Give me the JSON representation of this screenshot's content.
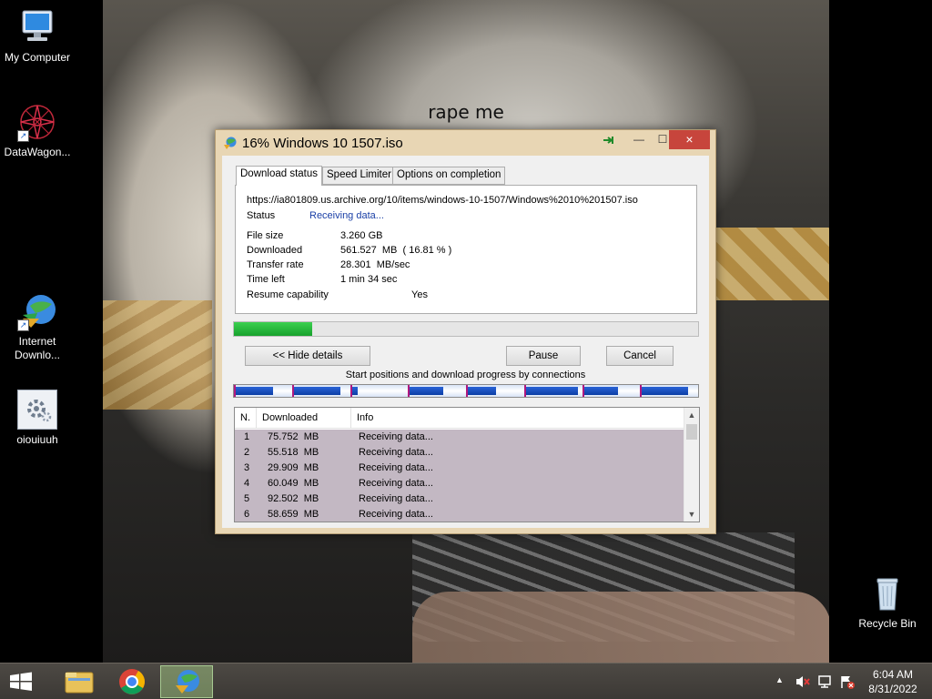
{
  "wallpaper": {
    "caption": "rape me"
  },
  "desktop_icons": [
    {
      "label": "My Computer"
    },
    {
      "label": "DataWagon..."
    },
    {
      "label": "Internet\nDownlo..."
    },
    {
      "label": "oiouiuuh"
    },
    {
      "label": "Recycle Bin"
    }
  ],
  "dialog": {
    "title": "16% Windows 10 1507.iso",
    "close_glyph": "×",
    "minimize_glyph": "—",
    "maximize_glyph": "☐",
    "tabs": [
      "Download status",
      "Speed Limiter",
      "Options on completion"
    ],
    "url": "https://ia801809.us.archive.org/10/items/windows-10-1507/Windows%2010%201507.iso",
    "status_label": "Status",
    "status_value": "Receiving data...",
    "status_color": "#1a3fa6",
    "file_size_label": "File size",
    "file_size_value": "3.260  GB",
    "downloaded_label": "Downloaded",
    "downloaded_value": "561.527  MB  ( 16.81 % )",
    "transfer_rate_label": "Transfer rate",
    "transfer_rate_value": "28.301  MB/sec",
    "time_left_label": "Time left",
    "time_left_value": "1 min 34 sec",
    "resume_label": "Resume capability",
    "resume_value": "Yes",
    "progress_fraction": 0.1681,
    "hide_details_button": "<< Hide details",
    "pause_button": "Pause",
    "cancel_button": "Cancel",
    "connections_label": "Start positions and download progress by connections",
    "connection_progress": [
      {
        "start": 0.0,
        "progress": 0.02
      },
      {
        "start": 0.125,
        "progress": 0.025
      },
      {
        "start": 0.25,
        "progress": 0.003
      },
      {
        "start": 0.375,
        "progress": 0.018
      },
      {
        "start": 0.5,
        "progress": 0.015
      },
      {
        "start": 0.625,
        "progress": 0.028
      },
      {
        "start": 0.75,
        "progress": 0.018
      },
      {
        "start": 0.875,
        "progress": 0.025
      }
    ],
    "table_headers": [
      "N.",
      "Downloaded",
      "Info"
    ],
    "connections": [
      {
        "n": "1",
        "downloaded": "75.752  MB",
        "info": "Receiving data..."
      },
      {
        "n": "2",
        "downloaded": "55.518  MB",
        "info": "Receiving data..."
      },
      {
        "n": "3",
        "downloaded": "29.909  MB",
        "info": "Receiving data..."
      },
      {
        "n": "4",
        "downloaded": "60.049  MB",
        "info": "Receiving data..."
      },
      {
        "n": "5",
        "downloaded": "92.502  MB",
        "info": "Receiving data..."
      },
      {
        "n": "6",
        "downloaded": "58.659  MB",
        "info": "Receiving data..."
      }
    ]
  },
  "taskbar": {
    "time": "6:04 AM",
    "date": "8/31/2022",
    "items": [
      "start-button",
      "file-explorer",
      "chrome",
      "internet-download-manager"
    ]
  }
}
